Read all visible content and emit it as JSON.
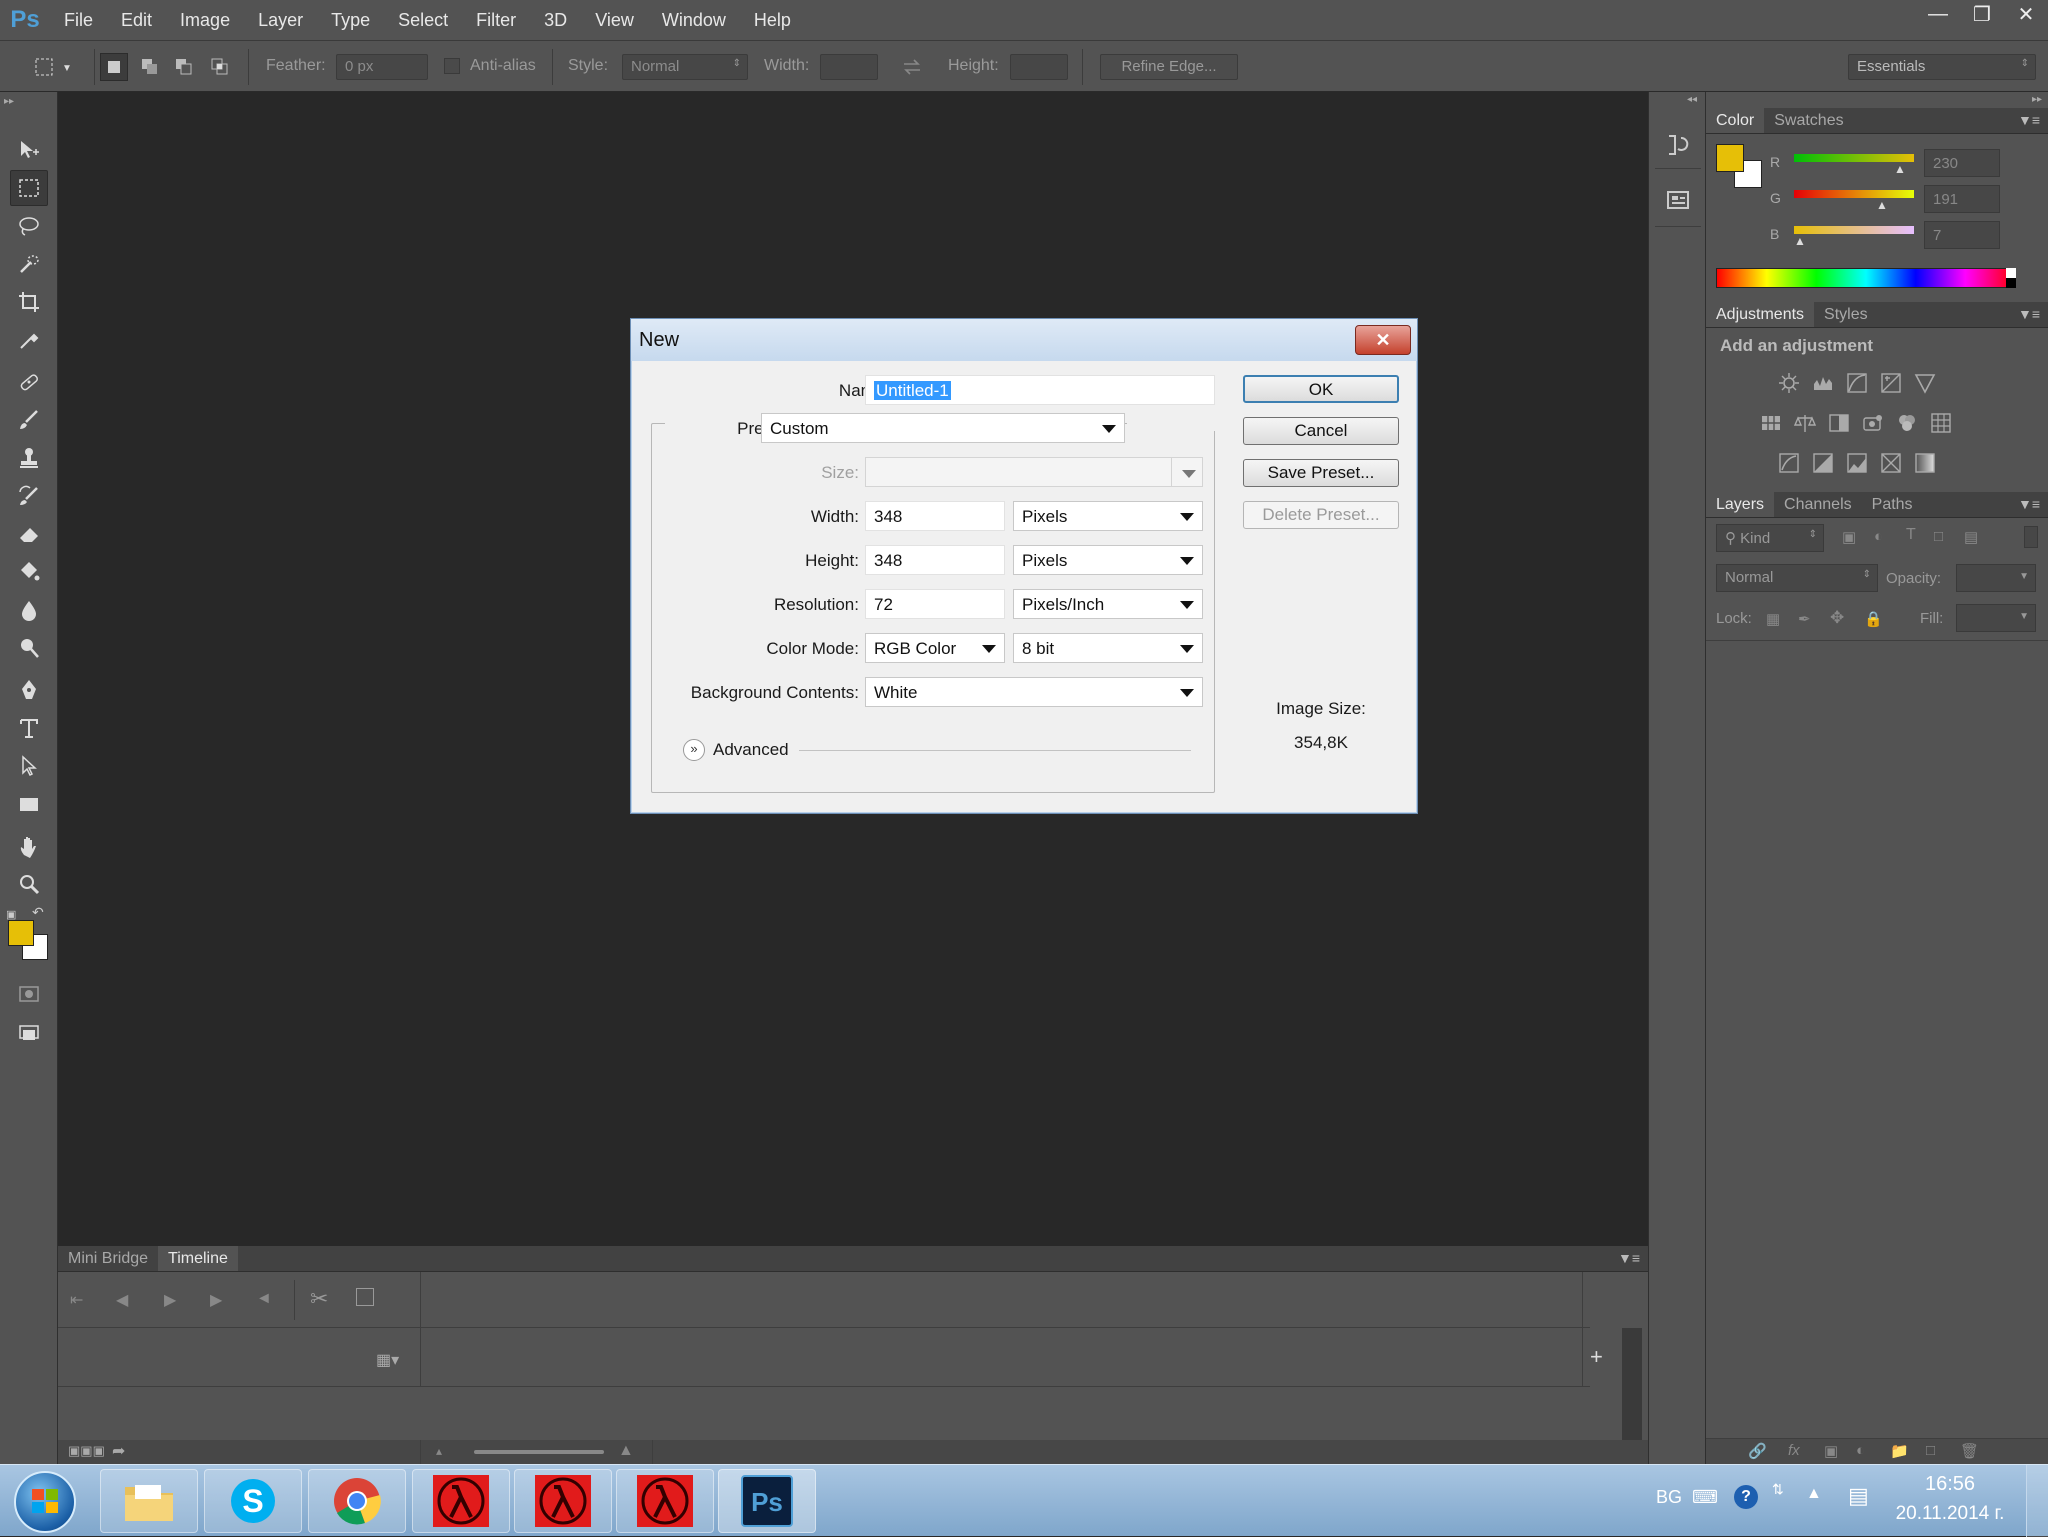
{
  "app": {
    "name": "Ps"
  },
  "menubar": {
    "items": [
      "File",
      "Edit",
      "Image",
      "Layer",
      "Type",
      "Select",
      "Filter",
      "3D",
      "View",
      "Window",
      "Help"
    ]
  },
  "options": {
    "feather_label": "Feather:",
    "feather_value": "0 px",
    "antialias_label": "Anti-alias",
    "style_label": "Style:",
    "style_value": "Normal",
    "width_label": "Width:",
    "height_label": "Height:",
    "refine_edge": "Refine Edge...",
    "workspace": "Essentials"
  },
  "color_panel": {
    "tabs": [
      "Color",
      "Swatches"
    ],
    "r_label": "R",
    "r_value": "230",
    "g_label": "G",
    "g_value": "191",
    "b_label": "B",
    "b_value": "7",
    "foreground": "#e6bf07",
    "background": "#ffffff"
  },
  "adjustments_panel": {
    "tabs": [
      "Adjustments",
      "Styles"
    ],
    "heading": "Add an adjustment"
  },
  "layers_panel": {
    "tabs": [
      "Layers",
      "Channels",
      "Paths"
    ],
    "kind": "Kind",
    "blend_mode": "Normal",
    "opacity_label": "Opacity:",
    "lock_label": "Lock:",
    "fill_label": "Fill:"
  },
  "bottom_panel": {
    "tabs": [
      "Mini Bridge",
      "Timeline"
    ]
  },
  "dialog": {
    "title": "New",
    "name_label": "Name:",
    "name_value": "Untitled-1",
    "preset_label": "Preset:",
    "preset_value": "Custom",
    "size_label": "Size:",
    "width_label": "Width:",
    "width_value": "348",
    "width_unit": "Pixels",
    "height_label": "Height:",
    "height_value": "348",
    "height_unit": "Pixels",
    "resolution_label": "Resolution:",
    "resolution_value": "72",
    "resolution_unit": "Pixels/Inch",
    "color_mode_label": "Color Mode:",
    "color_mode_value": "RGB Color",
    "bit_depth": "8 bit",
    "background_label": "Background Contents:",
    "background_value": "White",
    "advanced_label": "Advanced",
    "ok": "OK",
    "cancel": "Cancel",
    "save_preset": "Save Preset...",
    "delete_preset": "Delete Preset...",
    "image_size_label": "Image Size:",
    "image_size_value": "354,8K"
  },
  "taskbar": {
    "lang": "BG",
    "time": "16:56",
    "date": "20.11.2014 г."
  }
}
